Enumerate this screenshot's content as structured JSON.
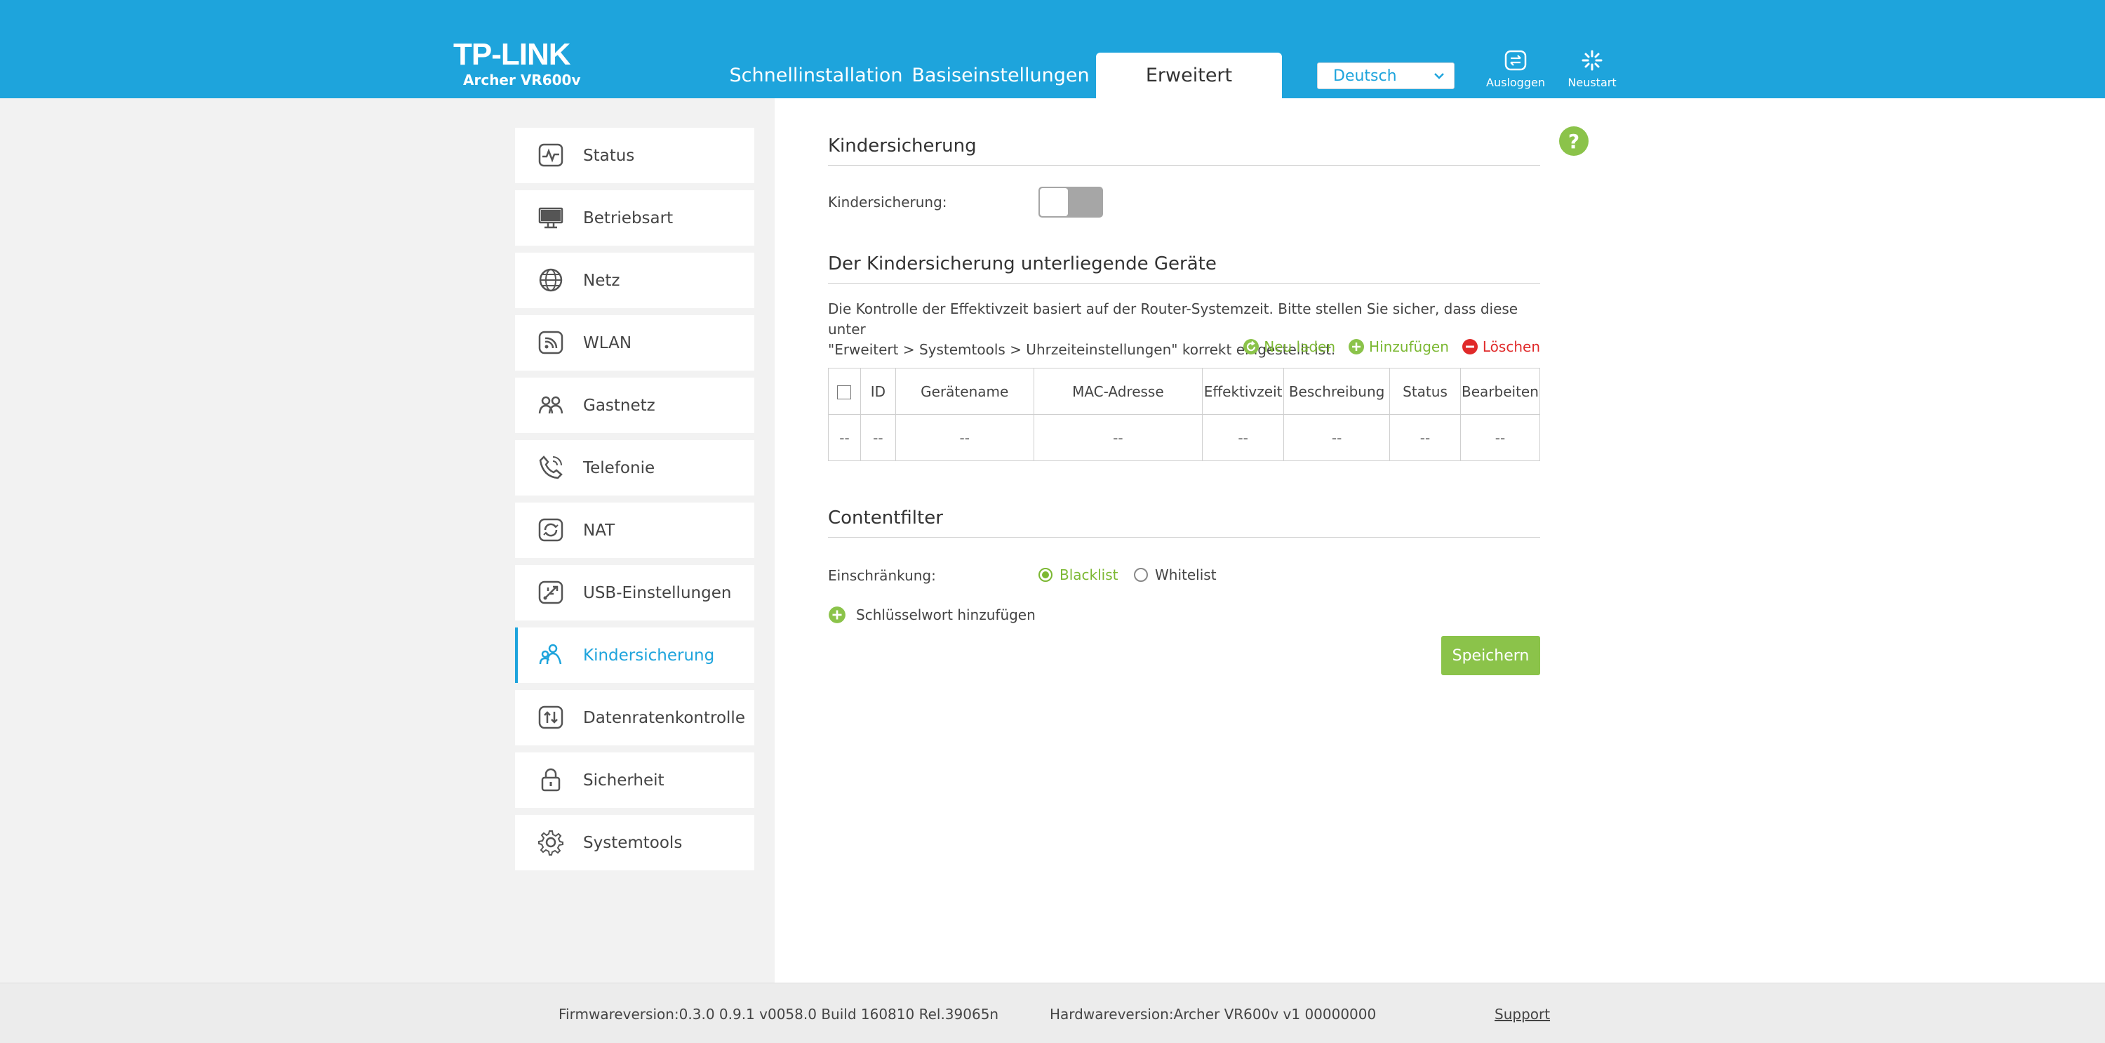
{
  "header": {
    "brand": "TP-LINK",
    "model": "Archer VR600v",
    "tabs": [
      {
        "label": "Schnellinstallation"
      },
      {
        "label": "Basiseinstellungen"
      },
      {
        "label": "Erweitert",
        "active": true
      }
    ],
    "language": "Deutsch",
    "logout_label": "Ausloggen",
    "restart_label": "Neustart"
  },
  "sidebar": {
    "items": [
      {
        "label": "Status",
        "icon": "pulse-icon"
      },
      {
        "label": "Betriebsart",
        "icon": "monitor-icon"
      },
      {
        "label": "Netz",
        "icon": "globe-icon"
      },
      {
        "label": "WLAN",
        "icon": "wifi-icon"
      },
      {
        "label": "Gastnetz",
        "icon": "guests-icon"
      },
      {
        "label": "Telefonie",
        "icon": "phone-icon"
      },
      {
        "label": "NAT",
        "icon": "nat-icon"
      },
      {
        "label": "USB-Einstellungen",
        "icon": "usb-icon"
      },
      {
        "label": "Kindersicherung",
        "icon": "parental-icon",
        "active": true
      },
      {
        "label": "Datenratenkontrolle",
        "icon": "bandwidth-icon"
      },
      {
        "label": "Sicherheit",
        "icon": "lock-icon"
      },
      {
        "label": "Systemtools",
        "icon": "gear-icon"
      }
    ]
  },
  "parental": {
    "title": "Kindersicherung",
    "toggle_label": "Kindersicherung:",
    "enabled": false
  },
  "devices": {
    "title": "Der Kindersicherung unterliegende Geräte",
    "note_line1": "Die Kontrolle der Effektivzeit basiert auf der Router-Systemzeit. Bitte stellen Sie sicher, dass diese unter",
    "note_line2": "\"Erweitert > Systemtools > Uhrzeiteinstellungen\" korrekt eingestellt ist.",
    "reload_label": "Neu laden",
    "add_label": "Hinzufügen",
    "delete_label": "Löschen",
    "columns": [
      "ID",
      "Gerätename",
      "MAC-Adresse",
      "Effektivzeit",
      "Beschreibung",
      "Status",
      "Bearbeiten"
    ],
    "rows": [
      [
        "--",
        "--",
        "--",
        "--",
        "--",
        "--",
        "--",
        "--"
      ]
    ]
  },
  "content_filter": {
    "title": "Contentfilter",
    "restriction_label": "Einschränkung:",
    "blacklist_label": "Blacklist",
    "whitelist_label": "Whitelist",
    "selected": "Blacklist",
    "add_keyword_label": "Schlüsselwort hinzufügen",
    "save_label": "Speichern"
  },
  "footer": {
    "firmware": "Firmwareversion:0.3.0 0.9.1 v0058.0 Build 160810 Rel.39065n",
    "hardware": "Hardwareversion:Archer VR600v v1 00000000",
    "support": "Support"
  },
  "colors": {
    "header": "#1ea4dc",
    "accent_green": "#8bc34a",
    "danger": "#e02a2a"
  }
}
